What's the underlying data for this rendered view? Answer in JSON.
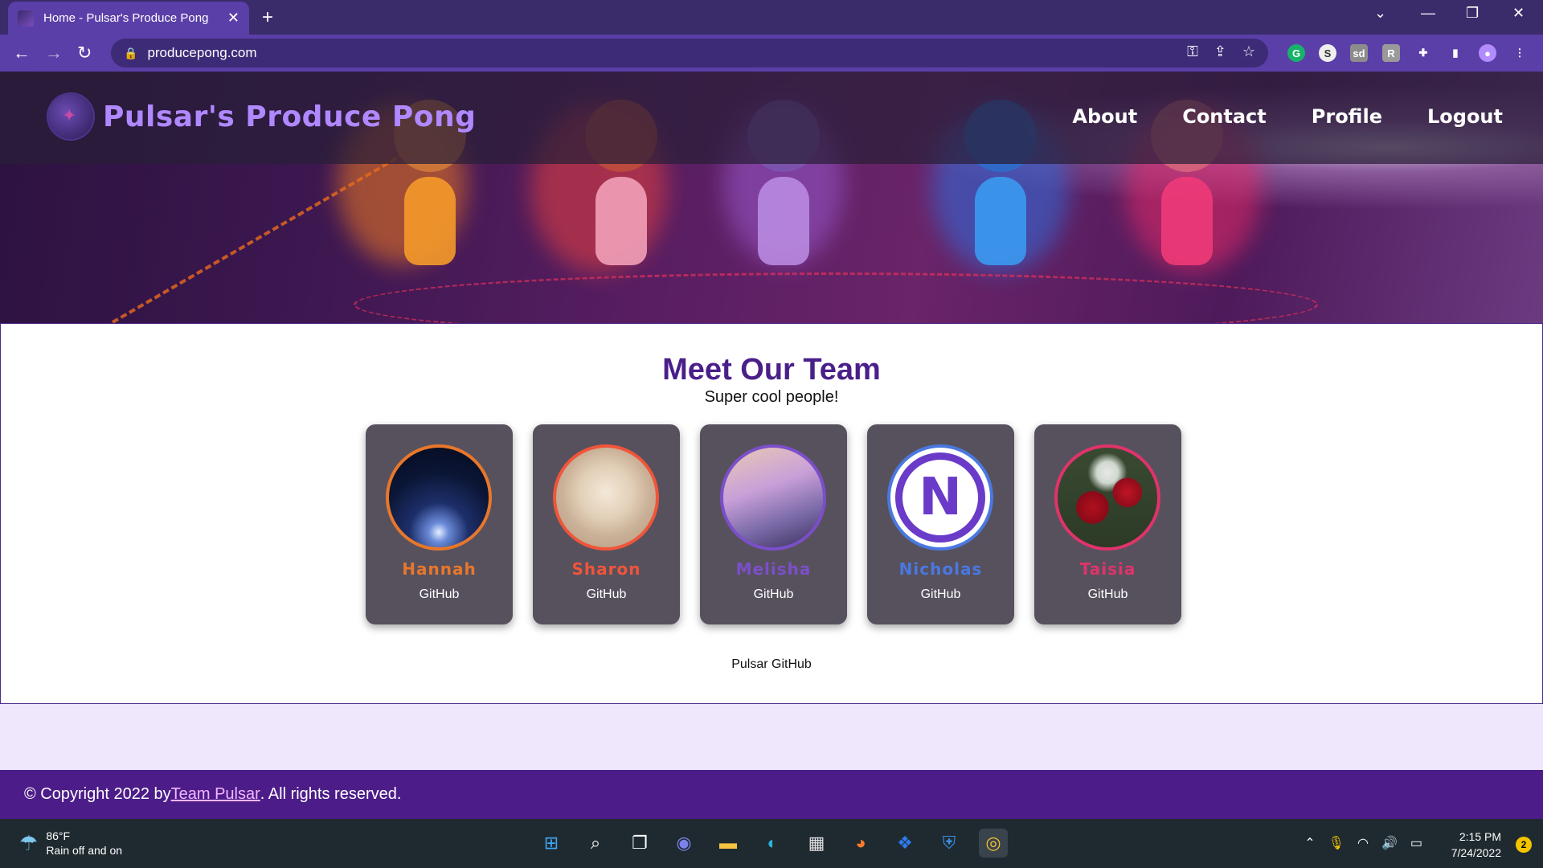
{
  "browser": {
    "tab_title": "Home - Pulsar's Produce Pong",
    "url": "producepong.com"
  },
  "site": {
    "brand": "Pulsar's Produce Pong",
    "nav": [
      {
        "label": "About"
      },
      {
        "label": "Contact"
      },
      {
        "label": "Profile"
      },
      {
        "label": "Logout"
      }
    ]
  },
  "team": {
    "title": "Meet Our Team",
    "subtitle": "Super cool people!",
    "members": [
      {
        "name": "Hannah",
        "link": "GitHub",
        "color": "#e8772a"
      },
      {
        "name": "Sharon",
        "link": "GitHub",
        "color": "#f0553a"
      },
      {
        "name": "Melisha",
        "link": "GitHub",
        "color": "#7b4fc9"
      },
      {
        "name": "Nicholas",
        "link": "GitHub",
        "color": "#4a78e0"
      },
      {
        "name": "Taisia",
        "link": "GitHub",
        "color": "#e0336a"
      }
    ],
    "org_link": "Pulsar GitHub"
  },
  "footer": {
    "prefix": "© Copyright 2022 by ",
    "team_link": "Team Pulsar",
    "suffix": ". All rights reserved."
  },
  "taskbar": {
    "temperature": "86°F",
    "weather": "Rain off and on",
    "time": "2:15 PM",
    "date": "7/24/2022",
    "notifications": "2"
  }
}
